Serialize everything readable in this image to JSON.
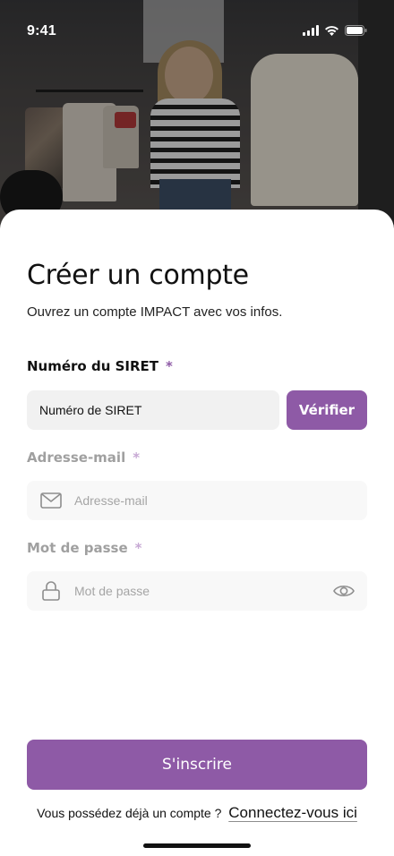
{
  "status_bar": {
    "time": "9:41",
    "icons": [
      "signal-icon",
      "wifi-icon",
      "battery-icon"
    ]
  },
  "hero": {
    "image": "woman holding clothes in a wardrobe"
  },
  "form": {
    "title": "Créer un compte",
    "subtitle": "Ouvrez un compte IMPACT avec vos infos.",
    "siret": {
      "label": "Numéro du SIRET",
      "required": "*",
      "value": "Numéro de SIRET"
    },
    "verify_label": "Vérifier",
    "email": {
      "label": "Adresse-mail",
      "required": "*",
      "placeholder": "Adresse-mail",
      "icon": "mail-icon"
    },
    "password": {
      "label": "Mot de passe",
      "required": "*",
      "placeholder": "Mot de passe",
      "icon": "lock-icon",
      "toggle_icon": "eye-icon"
    }
  },
  "actions": {
    "signup_label": "S'inscrire",
    "login_prompt": "Vous possédez déjà un compte ?",
    "login_link": "Connectez-vous ici"
  },
  "colors": {
    "accent": "#8e5aa6",
    "field_bg": "#f1f1f1",
    "text": "#111111"
  }
}
